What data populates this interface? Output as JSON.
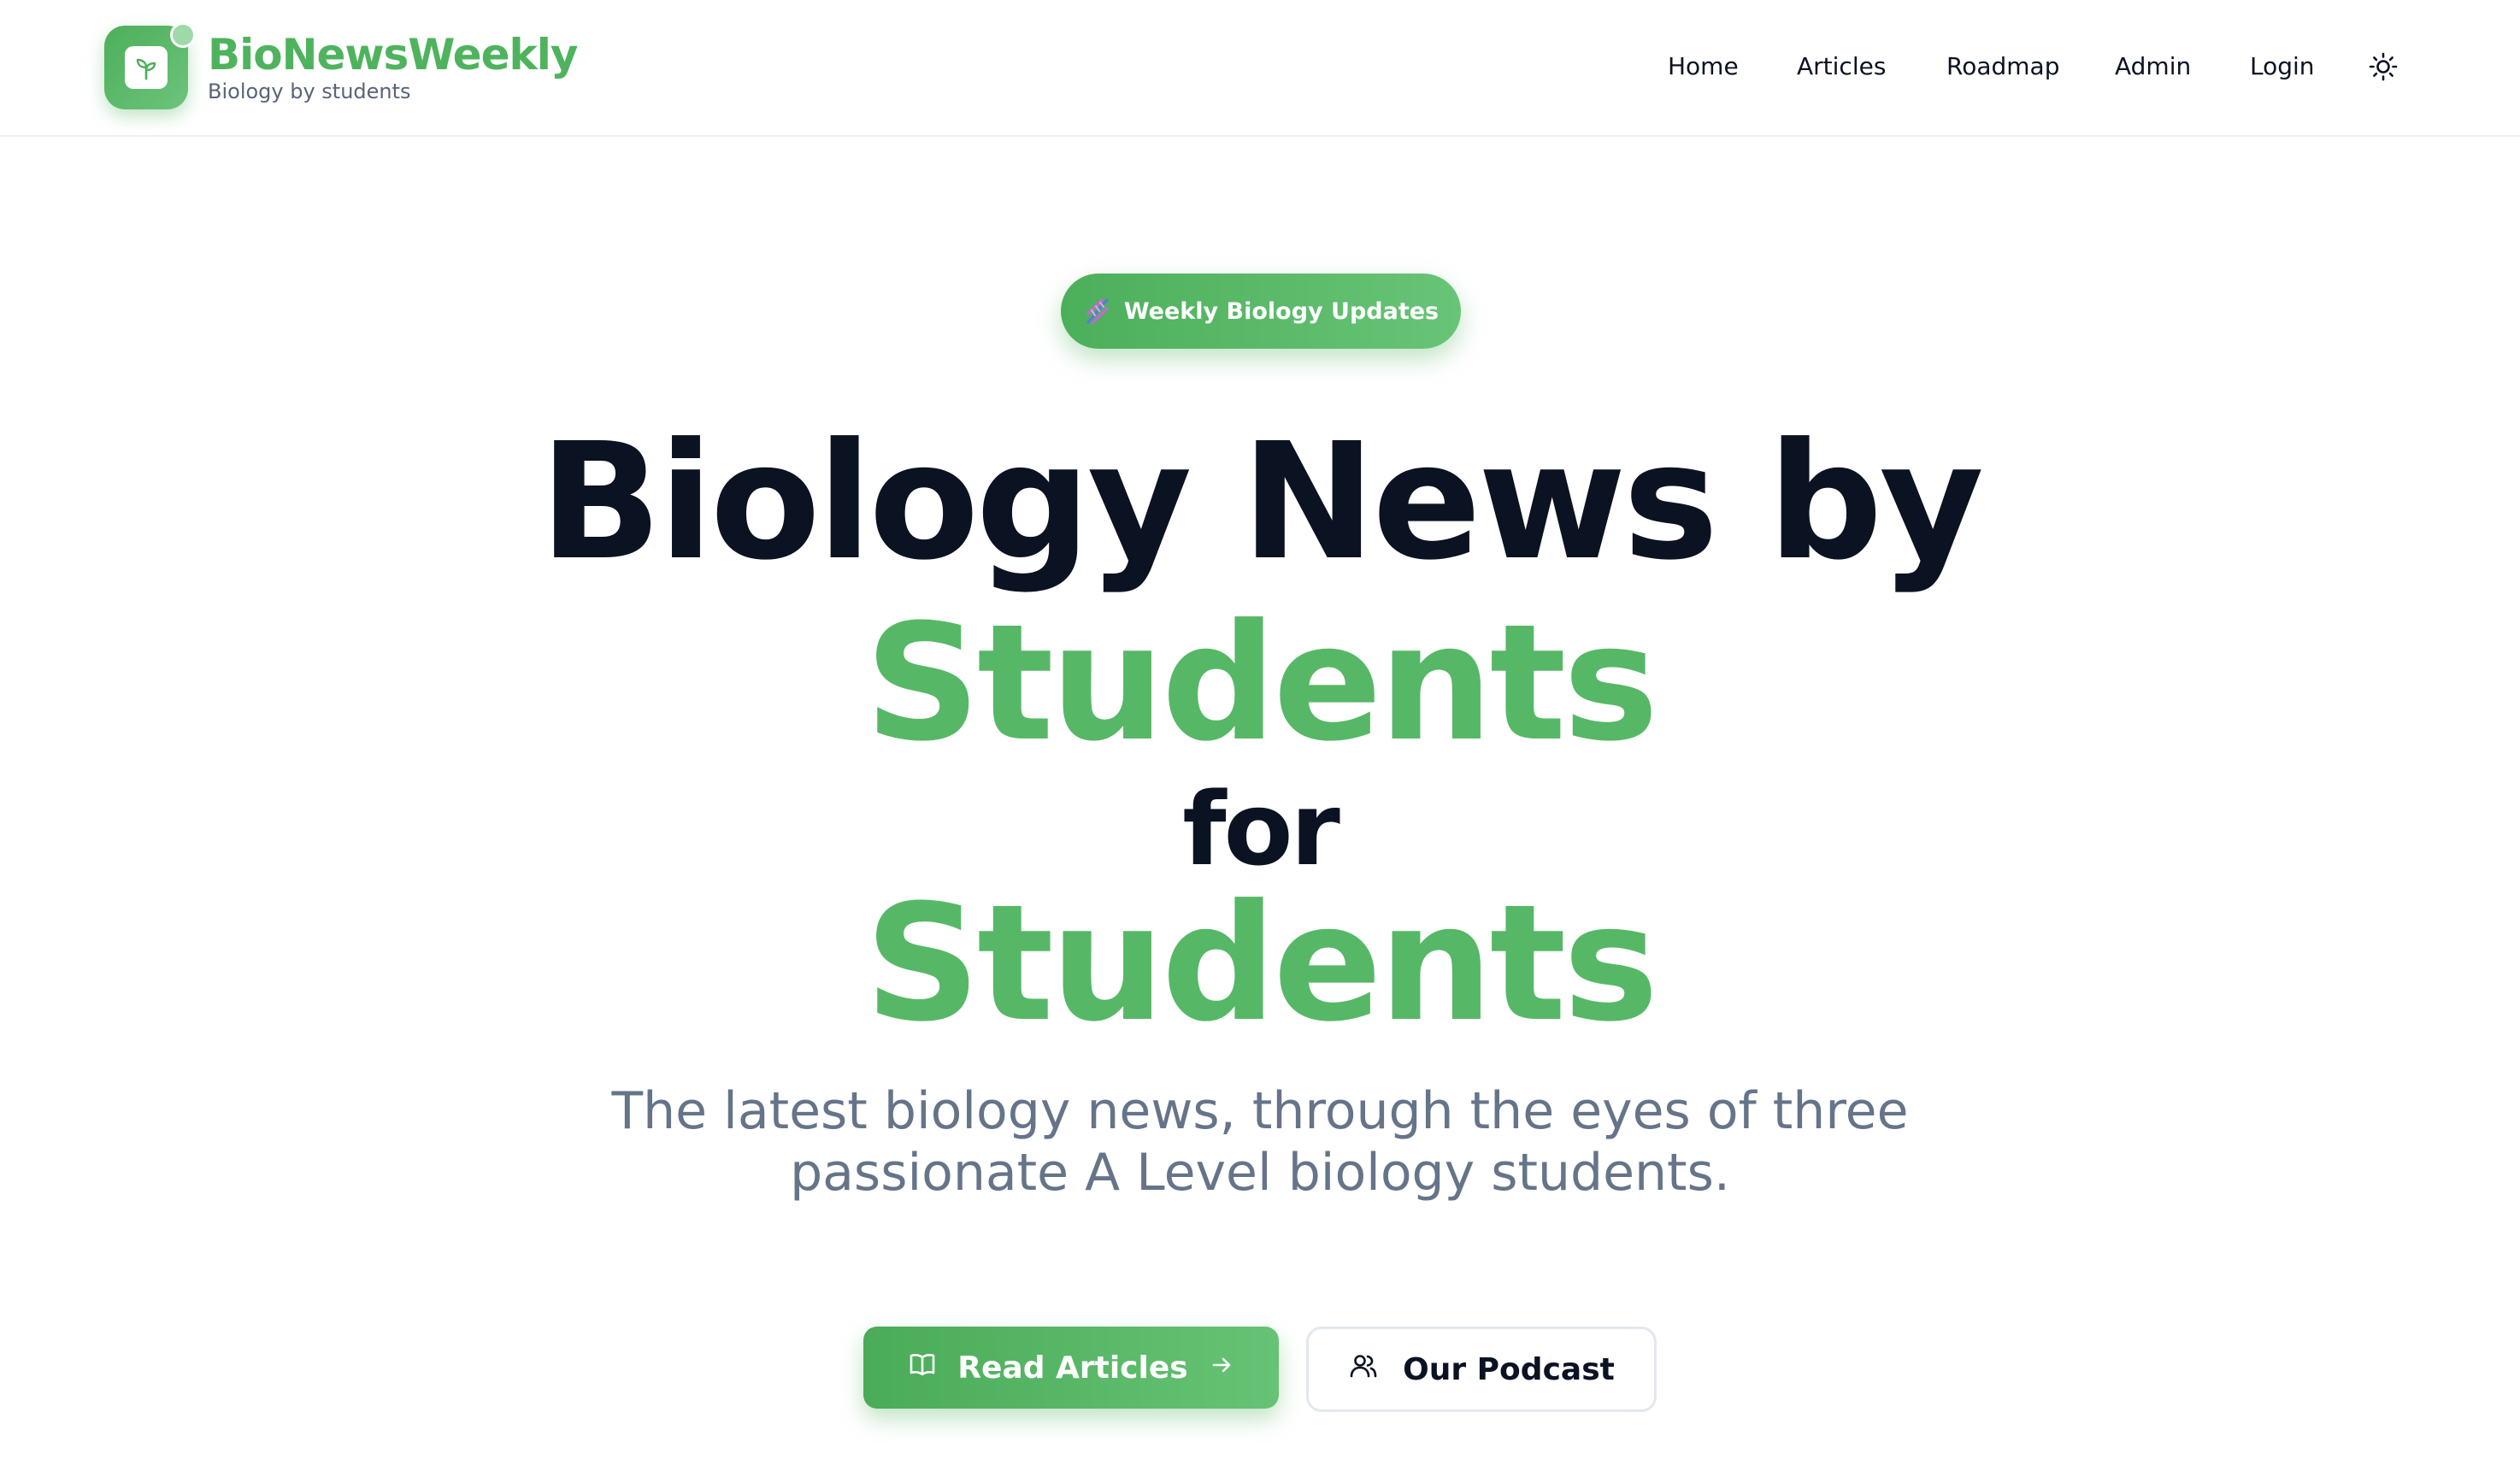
{
  "brand": {
    "name": "BioNewsWeekly",
    "tagline": "Biology by students"
  },
  "nav": {
    "items": [
      {
        "label": "Home"
      },
      {
        "label": "Articles"
      },
      {
        "label": "Roadmap"
      },
      {
        "label": "Admin"
      },
      {
        "label": "Login"
      }
    ],
    "theme_toggle_icon": "sun-icon"
  },
  "hero": {
    "badge": {
      "icon": "dna-emoji",
      "label": "Weekly Biology Updates"
    },
    "title_line1": "Biology News by",
    "title_line2": "Students",
    "title_line3": "for",
    "title_line4": "Students",
    "subtitle_line1": "The latest biology news, through the eyes of three",
    "subtitle_line2": "passionate A Level biology students."
  },
  "actions": {
    "primary": {
      "label": "Read Articles",
      "icon": "book-open-icon",
      "trailing_icon": "arrow-right-icon"
    },
    "secondary": {
      "label": "Our Podcast",
      "icon": "users-icon"
    }
  },
  "colors": {
    "brand_green": "#56b866",
    "heading_dark": "#0b1222",
    "subtitle_gray": "#66748a"
  }
}
